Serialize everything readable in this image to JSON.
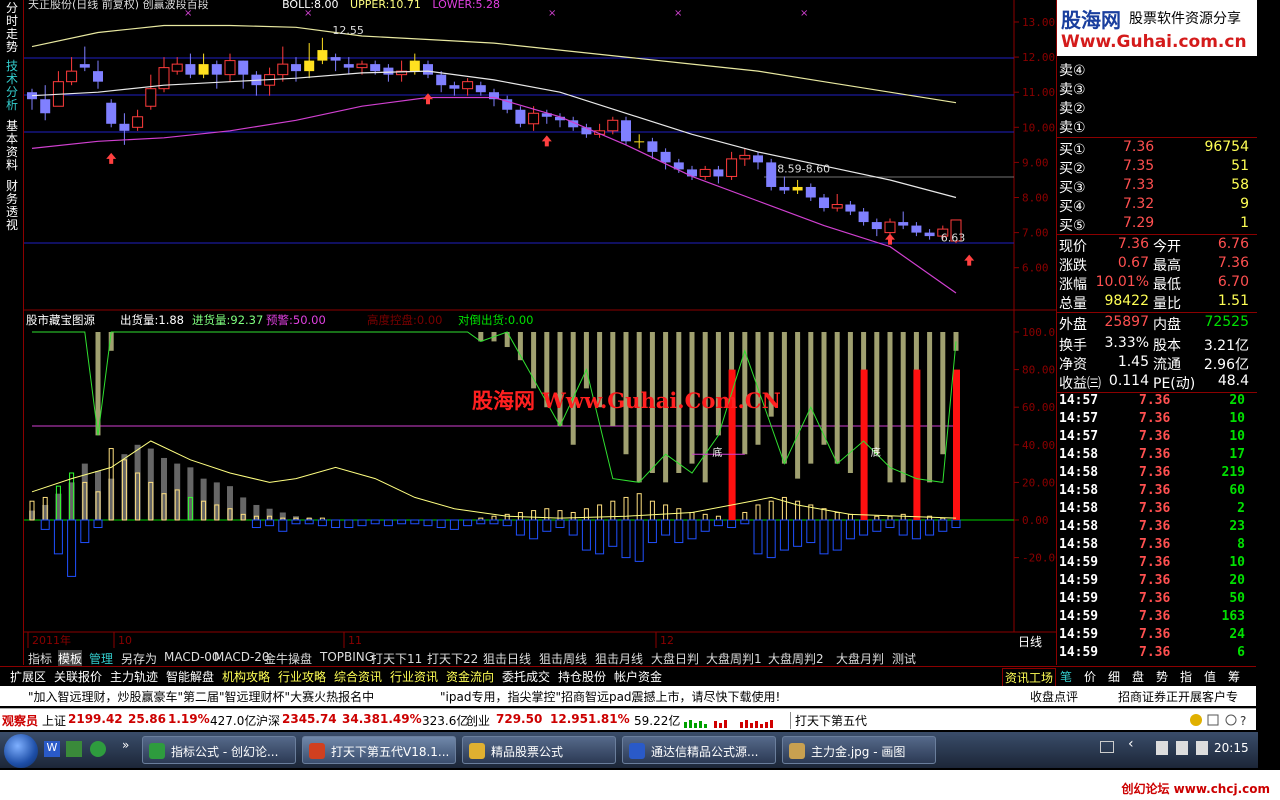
{
  "main_chart": {
    "title": "天正股份(日线 前复权) 创赢波段百段",
    "boll_label": "BOLL:8.00",
    "upper_label": "UPPER:10.71",
    "lower_label": "LOWER:5.28",
    "price_high_label": "12.55",
    "price_mid_label": "8.59-8.60",
    "price_low_label": "6.63",
    "y_ticks": [
      "13.00",
      "12.00",
      "11.00",
      "10.00",
      "9.00",
      "8.00",
      "7.00",
      "6.00"
    ]
  },
  "indicator": {
    "name": "股市藏宝图源",
    "out_label": "出货量:1.88",
    "in_label": "进货量:92.37",
    "warn_label": "预警:50.00",
    "top_label": "高度控盘:0.00",
    "reverse_label": "对倒出货:0.00",
    "watermark": "股海网 Www.Guhai.Com.CN",
    "y_ticks": [
      "100.0",
      "80.00",
      "60.00",
      "40.00",
      "20.00",
      "0.00",
      "-20.00"
    ],
    "di_label": "底"
  },
  "x_axis": {
    "labels": [
      "2011年",
      "10",
      "11",
      "12"
    ],
    "period": "日线"
  },
  "left_tabs": [
    "分时走势",
    "技术分析",
    "基本资料",
    "财务透视"
  ],
  "logo": {
    "name": "股海网",
    "subtitle": "股票软件资源分享",
    "url": "Www.Guhai.com.cn"
  },
  "order_book": {
    "sell": [
      {
        "label": "卖④"
      },
      {
        "label": "卖③"
      },
      {
        "label": "卖②"
      },
      {
        "label": "卖①"
      }
    ],
    "buy": [
      {
        "label": "买①",
        "price": "7.36",
        "vol": "96754"
      },
      {
        "label": "买②",
        "price": "7.35",
        "vol": "51"
      },
      {
        "label": "买③",
        "price": "7.33",
        "vol": "58"
      },
      {
        "label": "买④",
        "price": "7.32",
        "vol": "9"
      },
      {
        "label": "买⑤",
        "price": "7.29",
        "vol": "1"
      }
    ]
  },
  "quote": [
    {
      "k1": "现价",
      "v1": "7.36",
      "k2": "今开",
      "v2": "6.76"
    },
    {
      "k1": "涨跌",
      "v1": "0.67",
      "k2": "最高",
      "v2": "7.36"
    },
    {
      "k1": "涨幅",
      "v1": "10.01%",
      "k2": "最低",
      "v2": "6.70"
    },
    {
      "k1": "总量",
      "v1": "98422",
      "k2": "量比",
      "v2": "1.51"
    },
    {
      "k1": "外盘",
      "v1": "25897",
      "k2": "内盘",
      "v2": "72525"
    },
    {
      "k1": "换手",
      "v1": "3.33%",
      "k2": "股本",
      "v2": "3.21亿"
    },
    {
      "k1": "净资",
      "v1": "1.45",
      "k2": "流通",
      "v2": "2.96亿"
    },
    {
      "k1": "收益㈢",
      "v1": "0.114",
      "k2": "PE(动)",
      "v2": "48.4"
    }
  ],
  "ticks": [
    {
      "time": "14:57",
      "price": "7.36",
      "vol": "20"
    },
    {
      "time": "14:57",
      "price": "7.36",
      "vol": "10"
    },
    {
      "time": "14:57",
      "price": "7.36",
      "vol": "10"
    },
    {
      "time": "14:58",
      "price": "7.36",
      "vol": "17"
    },
    {
      "time": "14:58",
      "price": "7.36",
      "vol": "219"
    },
    {
      "time": "14:58",
      "price": "7.36",
      "vol": "60"
    },
    {
      "time": "14:58",
      "price": "7.36",
      "vol": "2"
    },
    {
      "time": "14:58",
      "price": "7.36",
      "vol": "23"
    },
    {
      "time": "14:58",
      "price": "7.36",
      "vol": "8"
    },
    {
      "time": "14:59",
      "price": "7.36",
      "vol": "10"
    },
    {
      "time": "14:59",
      "price": "7.36",
      "vol": "20"
    },
    {
      "time": "14:59",
      "price": "7.36",
      "vol": "50"
    },
    {
      "time": "14:59",
      "price": "7.36",
      "vol": "163"
    },
    {
      "time": "14:59",
      "price": "7.36",
      "vol": "24"
    },
    {
      "time": "14:59",
      "price": "7.36",
      "vol": "6"
    }
  ],
  "toolbar1": [
    "指标",
    "模板",
    "管理",
    "另存为",
    "MACD-00",
    "MACD-20",
    "金牛操盘",
    "TOPBING",
    "打天下11",
    "打天下22",
    "狙击日线",
    "狙击周线",
    "狙击月线",
    "大盘日判",
    "大盘周判1",
    "大盘周判2",
    "大盘月判",
    "测试"
  ],
  "toolbar2": [
    "扩展区",
    "关联报价",
    "主力轨迹",
    "智能解盘",
    "机构攻略",
    "行业攻略",
    "综合资讯",
    "行业资讯",
    "资金流向",
    "委托成交",
    "持仓股份",
    "帐户资金"
  ],
  "toolbar2_right": "资讯工场",
  "right_tabs": [
    "笔",
    "价",
    "细",
    "盘",
    "势",
    "指",
    "值",
    "筹"
  ],
  "news": {
    "item1": "\"加入智远理财，炒股赢豪车\"第二届\"智远理财杯\"大赛火热报名中",
    "item2": "\"ipad专用，指尖掌控\"招商智远pad震撼上市，请尽快下载使用!",
    "item3": "收盘点评",
    "item4": "招商证券正开展客户专"
  },
  "index_bar": {
    "observer": "观察员",
    "sh_label": "上证",
    "sh_value": "2199.42",
    "sh_change": "25.86",
    "sh_pct": "1.19%",
    "sh_amount": "427.0亿",
    "sz_label": "沪深",
    "sz_value": "2345.74",
    "sz_change": "34.38",
    "sz_pct": "1.49%",
    "sz_amount": "323.6亿",
    "cy_label": "创业",
    "cy_value": "729.50",
    "cy_change": "12.95",
    "cy_pct": "1.81%",
    "cy_amount": "59.22亿",
    "formula": "打天下第五代"
  },
  "taskbar": {
    "items": [
      "指标公式 - 创幻论...",
      "打天下第五代V18.1...",
      "精品股票公式",
      "通达信精品公式源...",
      "主力金.jpg - 画图"
    ],
    "time": "20:15"
  },
  "footer": {
    "credit": "创幻论坛 www.chcj.com"
  },
  "colors": {
    "up": "#ff3c3c",
    "down": "#8080ff",
    "grid": "#8b0000",
    "upper": "#e8e8a0",
    "boll": "#e8e8e8",
    "lower": "#d040d0"
  }
}
